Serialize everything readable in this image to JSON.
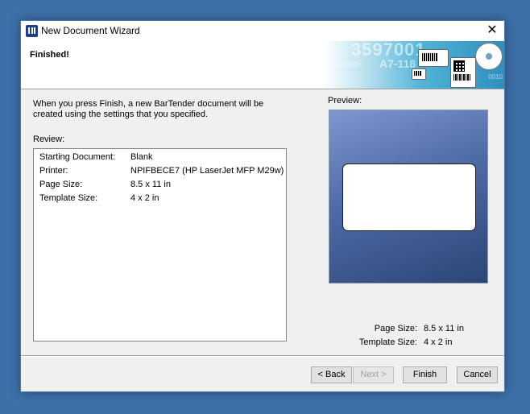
{
  "window": {
    "title": "New Document Wizard",
    "close_glyph": "✕"
  },
  "header": {
    "title": "Finished!",
    "banner_number": "3597001",
    "banner_code": "A7-118",
    "banner_sub": "Barcode",
    "banner_binary": "0010"
  },
  "intro": {
    "text": "When you press Finish, a new BarTender document will be created using the settings that you specified."
  },
  "review": {
    "label": "Review:",
    "rows": [
      {
        "key": "Starting Document:",
        "value": "Blank"
      },
      {
        "key": "Printer:",
        "value": "NPIFBECE7 (HP LaserJet MFP M29w)"
      },
      {
        "key": "Page Size:",
        "value": "8.5 x 11 in"
      },
      {
        "key": "Template Size:",
        "value": "4 x 2 in"
      }
    ]
  },
  "preview": {
    "label": "Preview:",
    "page_size_label": "Page Size:",
    "page_size_value": "8.5 x 11 in",
    "template_size_label": "Template Size:",
    "template_size_value": "4 x 2 in"
  },
  "buttons": {
    "back": "< Back",
    "next": "Next >",
    "finish": "Finish",
    "cancel": "Cancel"
  }
}
